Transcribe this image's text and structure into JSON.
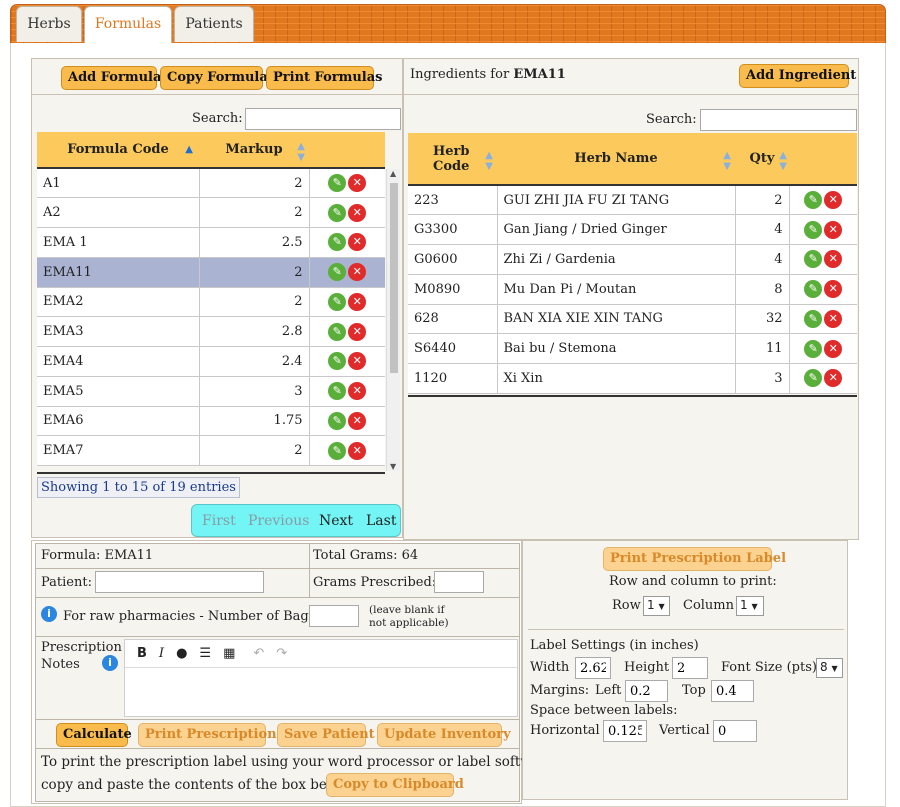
{
  "tabs": [
    {
      "label": "Herbs"
    },
    {
      "label": "Formulas"
    },
    {
      "label": "Patients"
    }
  ],
  "formulas_panel": {
    "add_formula": "Add Formula",
    "copy_formula": "Copy Formula",
    "print_formulas": "Print Formulas",
    "search_label": "Search:",
    "columns": [
      "Formula Code",
      "Markup"
    ],
    "rows": [
      {
        "code": "A1",
        "markup": "2"
      },
      {
        "code": "A2",
        "markup": "2"
      },
      {
        "code": "EMA 1",
        "markup": "2.5"
      },
      {
        "code": "EMA11",
        "markup": "2"
      },
      {
        "code": "EMA2",
        "markup": "2"
      },
      {
        "code": "EMA3",
        "markup": "2.8"
      },
      {
        "code": "EMA4",
        "markup": "2.4"
      },
      {
        "code": "EMA5",
        "markup": "3"
      },
      {
        "code": "EMA6",
        "markup": "1.75"
      },
      {
        "code": "EMA7",
        "markup": "2"
      }
    ],
    "info": "Showing 1 to 15 of 19 entries",
    "pager": {
      "first": "First",
      "previous": "Previous",
      "next": "Next",
      "last": "Last"
    }
  },
  "ingredients_panel": {
    "title_prefix": "Ingredients for",
    "formula": "EMA11",
    "add_ingredient": "Add Ingredient",
    "search_label": "Search:",
    "col_code_1": "Herb",
    "col_code_2": "Code",
    "col_name": "Herb Name",
    "col_qty": "Qty",
    "rows": [
      {
        "code": "223",
        "name": "GUI ZHI JIA FU ZI TANG",
        "qty": "2"
      },
      {
        "code": "G3300",
        "name": "Gan Jiang / Dried Ginger",
        "qty": "4"
      },
      {
        "code": "G0600",
        "name": "Zhi Zi / Gardenia",
        "qty": "4"
      },
      {
        "code": "M0890",
        "name": "Mu Dan Pi / Moutan",
        "qty": "8"
      },
      {
        "code": "628",
        "name": "BAN XIA XIE XIN TANG",
        "qty": "32"
      },
      {
        "code": "S6440",
        "name": "Bai bu / Stemona",
        "qty": "11"
      },
      {
        "code": "1120",
        "name": "Xi Xin",
        "qty": "3"
      }
    ]
  },
  "prescription": {
    "formula_label": "Formula: EMA11",
    "total_grams": "Total Grams: 64",
    "patient_label": "Patient:",
    "patient_value": "",
    "grams_prescribed_label": "Grams Prescribed:",
    "grams_prescribed_value": "",
    "bags_label": "For raw pharmacies - Number of Bags:",
    "bags_value": "",
    "bags_note_1": "(leave blank if",
    "bags_note_2": "not applicable)",
    "notes_label_1": "Prescription",
    "notes_label_2": "Notes",
    "calculate": "Calculate",
    "print_prescription": "Print Prescription",
    "save_patient": "Save Patient",
    "update_inventory": "Update Inventory",
    "copy_text_1": "To print the prescription label using your word processor or label software,",
    "copy_text_2": "copy and paste the contents of the box below.",
    "copy_clipboard": "Copy to Clipboard"
  },
  "label_panel": {
    "print_label": "Print Prescription Label",
    "row_col_text": "Row and column to print:",
    "row_label": "Row",
    "row_value": "1",
    "column_label": "Column",
    "column_value": "1",
    "settings_title": "Label Settings (in inches)",
    "width_label": "Width",
    "width_value": "2.62",
    "height_label": "Height",
    "height_value": "2",
    "font_size_label": "Font Size (pts)",
    "font_size_value": "8",
    "margins_label": "Margins:",
    "left_label": "Left",
    "left_value": "0.2",
    "top_label": "Top",
    "top_value": "0.4",
    "space_label": "Space between labels:",
    "horizontal_label": "Horizontal",
    "horizontal_value": "0.125",
    "vertical_label": "Vertical",
    "vertical_value": "0"
  },
  "colors": {
    "accent": "#e0781f",
    "button": "#f8bb4c",
    "header": "#fcca5c",
    "selected_row": "#aab4d2",
    "pager": "#73f5f5",
    "edit_icon": "#5aae3a",
    "delete_icon": "#e12a2a"
  }
}
